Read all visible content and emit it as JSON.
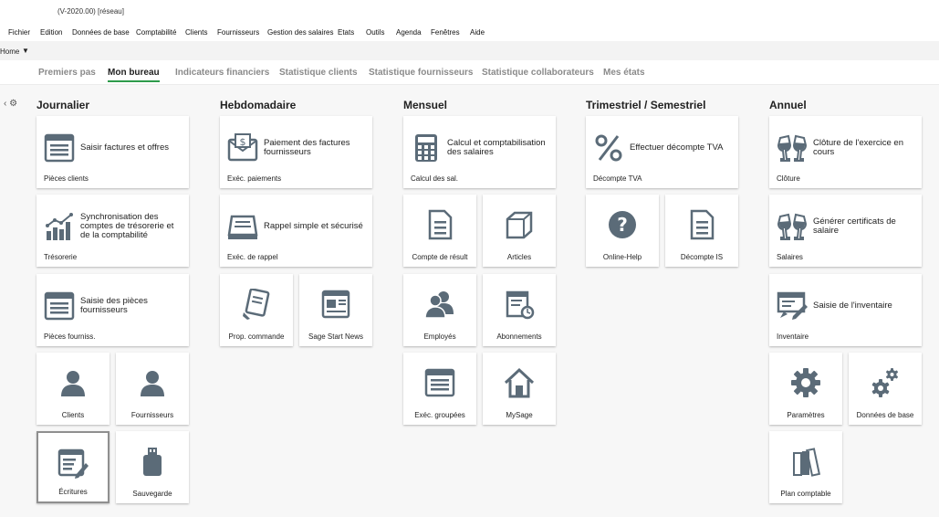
{
  "window": {
    "title": "(V-2020.00) [réseau]"
  },
  "menu": [
    "Fichier",
    "Edition",
    "Données de base",
    "Comptabilité",
    "Clients",
    "Fournisseurs",
    "Gestion des salaires",
    "Etats",
    "Outils",
    "Agenda",
    "Fenêtres",
    "Aide"
  ],
  "home": {
    "label": "Home",
    "caret": "▼"
  },
  "tabs": [
    "Premiers pas",
    "Mon bureau",
    "Indicateurs financiers",
    "Statistique clients",
    "Statistique fournisseurs",
    "Statistique collaborateurs",
    "Mes états"
  ],
  "active_tab": "Mon bureau",
  "columns": {
    "journalier": {
      "title": "Journalier",
      "tiles": [
        {
          "text": "Saisir factures et offres",
          "label": "Pièces clients",
          "icon": "invoice-list-icon"
        },
        {
          "text": "Synchronisation des comptes de trésorerie et de la comptabilité",
          "label": "Trésorerie",
          "icon": "bar-chart-icon"
        },
        {
          "text": "Saisie des pièces fournisseurs",
          "label": "Pièces fourniss.",
          "icon": "invoice-list-icon"
        },
        {
          "label": "Clients",
          "icon": "person-icon"
        },
        {
          "label": "Fournisseurs",
          "icon": "person-icon"
        },
        {
          "label": "Écritures",
          "icon": "entries-icon"
        },
        {
          "label": "Sauvegarde",
          "icon": "usb-drive-icon"
        }
      ]
    },
    "hebdo": {
      "title": "Hebdomadaire",
      "tiles": [
        {
          "text": "Paiement des factures fournisseurs",
          "label": "Exéc. paiements",
          "icon": "payment-icon"
        },
        {
          "text": "Rappel simple et sécurisé",
          "label": "Exéc. de rappel",
          "icon": "reminder-icon"
        },
        {
          "label": "Prop. commande",
          "icon": "order-icon"
        },
        {
          "label": "Sage Start News",
          "icon": "newspaper-icon"
        }
      ]
    },
    "mensuel": {
      "title": "Mensuel",
      "tiles": [
        {
          "text": "Calcul et comptabilisation des salaires",
          "label": "Calcul des sal.",
          "icon": "calculator-icon"
        },
        {
          "label": "Compte de résult",
          "icon": "document-icon"
        },
        {
          "label": "Articles",
          "icon": "box-icon"
        },
        {
          "label": "Employés",
          "icon": "people-icon"
        },
        {
          "label": "Abonnements",
          "icon": "subscription-icon"
        },
        {
          "label": "Exéc. groupées",
          "icon": "invoice-list-icon"
        },
        {
          "label": "MySage",
          "icon": "home-icon"
        }
      ]
    },
    "trimestriel": {
      "title": "Trimestriel / Semestriel",
      "tiles": [
        {
          "text": "Effectuer décompte TVA",
          "label": "Décompte TVA",
          "icon": "percent-icon"
        },
        {
          "label": "Online-Help",
          "icon": "help-icon"
        },
        {
          "label": "Décompte IS",
          "icon": "document-icon"
        }
      ]
    },
    "annuel": {
      "title": "Annuel",
      "tiles": [
        {
          "text": "Clôture de l'exercice en cours",
          "label": "Clôture",
          "icon": "champagne-icon"
        },
        {
          "text": "Générer certificats de salaire",
          "label": "Salaires",
          "icon": "champagne-icon"
        },
        {
          "text": "Saisie de l'inventaire",
          "label": "Inventaire",
          "icon": "inventory-icon"
        },
        {
          "label": "Paramètres",
          "icon": "gear-icon"
        },
        {
          "label": "Données de base",
          "icon": "gears-icon"
        },
        {
          "label": "Plan comptable",
          "icon": "books-icon"
        }
      ]
    }
  },
  "colors": {
    "icon": "#5b6b78",
    "accent": "#2e9b4b"
  }
}
